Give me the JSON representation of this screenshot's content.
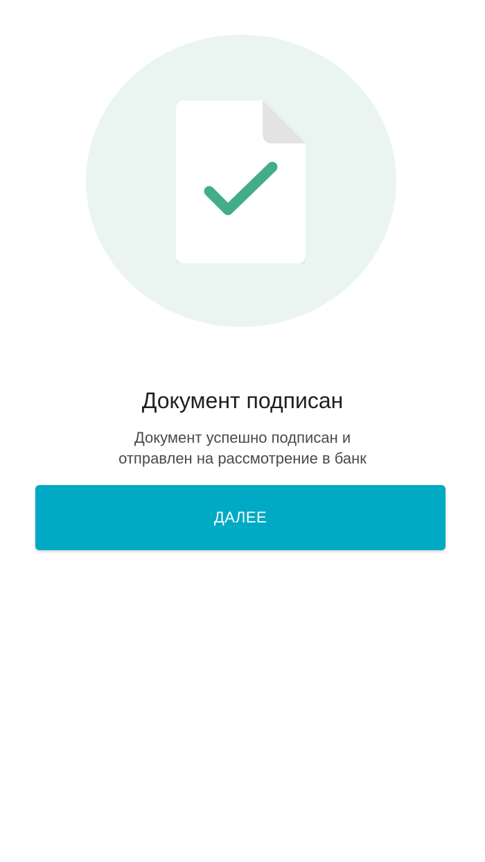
{
  "illustration": {
    "icon": "document-check-icon",
    "circle_color": "#eaf5f1",
    "check_color": "#43ad87"
  },
  "content": {
    "title": "Документ подписан",
    "subtitle_line1": "Документ успешно подписан и",
    "subtitle_line2": "отправлен на рассмотрение в банк"
  },
  "actions": {
    "next_label": "ДАЛЕЕ",
    "button_color": "#00aac4"
  }
}
